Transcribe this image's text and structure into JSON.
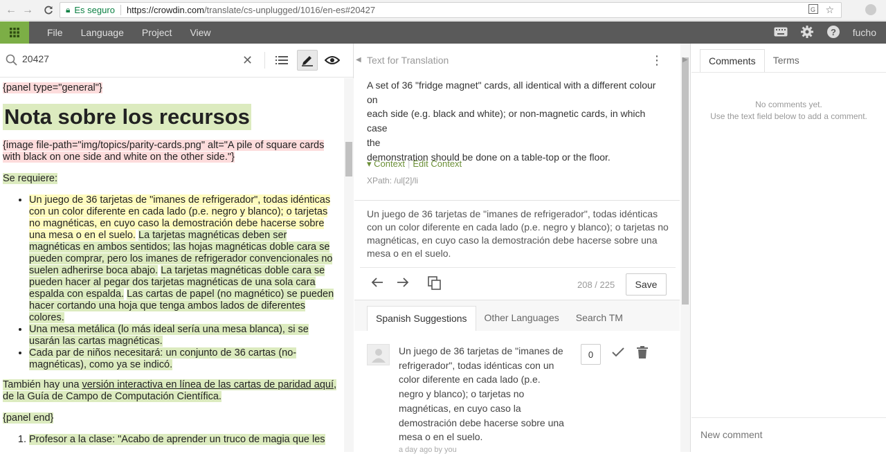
{
  "browser": {
    "secure_label": "Es seguro",
    "url_host": "https://crowdin.com",
    "url_path": "/translate/cs-unplugged/1016/en-es#20427"
  },
  "header": {
    "menu": [
      "File",
      "Language",
      "Project",
      "View"
    ],
    "username": "fucho"
  },
  "search": {
    "value": "20427"
  },
  "document": {
    "panel_start": "{panel type=\"general\"}",
    "title": "Nota sobre los recursos",
    "image_tag": "{image file-path=\"img/topics/parity-cards.png\" alt=\"A pile of square cards with black on one side and white on the other side.\"}",
    "requires": "Se requiere:",
    "item1_a": "Un juego de 36 tarjetas de \"imanes de refrigerador\", todas idénticas con un color diferente en cada lado (p.e. negro y blanco); o tarjetas no magnéticas, en cuyo caso la demostración debe hacerse sobre una mesa o en el suelo.",
    "item1_b": "La tarjetas magnéticas deben ser magnéticas en ambos sentidos; las hojas magnéticas doble cara se pueden comprar, pero los imanes de refrigerador convencionales no suelen adherirse boca abajo.",
    "item1_c": "La tarjetas magnéticas doble cara se pueden hacer al pegar dos tarjetas magnéticas de una sola cara espalda con espalda.",
    "item1_d": "Las cartas de papel (no magnético) se pueden hacer cortando una hoja que tenga ambos lados de diferentes colores.",
    "item2": "Una mesa metálica (lo más ideal sería una mesa blanca), si se usarán las cartas magnéticas.",
    "item3": "Cada par de niños necesitará: un conjunto de 36 cartas (no-magnéticas), como ya se indicó.",
    "also_pre": "También hay una ",
    "also_link": "versión interactiva en línea de las cartas de paridad aquí",
    "also_post": ", de la Guía de Campo de Computación Científica.",
    "panel_end": "{panel end}",
    "ol_item1": "Profesor a la clase: \"Acabo de aprender un truco de magia que les"
  },
  "editor": {
    "label": "Text for Translation",
    "source_lines": [
      "A set of 36 \"fridge magnet\" cards, all identical with a different colour",
      "on",
      "each side (e.g. black and white); or non-magnetic cards, in which case",
      "the",
      "demonstration should be done on a table-top or the floor."
    ],
    "context": "Context",
    "edit_context": "Edit Context",
    "xpath": "XPath: /ul[2]/li",
    "translation": "Un juego de 36 tarjetas de \"imanes de refrigerador\", todas idénticas con un color diferente en cada lado (p.e. negro y blanco); o tarjetas no magnéticas, en cuyo caso la demostración debe hacerse sobre una mesa o en el suelo.",
    "char_count": "208 / 225",
    "save": "Save"
  },
  "suggestions": {
    "tabs": [
      "Spanish Suggestions",
      "Other Languages",
      "Search TM"
    ],
    "text": "Un juego de 36 tarjetas de \"imanes de refrigerador\", todas idénticas con un color diferente en cada lado (p.e. negro y blanco); o tarjetas no magnéticas, en cuyo caso la demostración debe hacerse sobre una mesa o en el suelo.",
    "votes": "0",
    "meta": "a day ago by you"
  },
  "comments": {
    "tabs": [
      "Comments",
      "Terms"
    ],
    "empty_1": "No comments yet.",
    "empty_2": "Use the text field below to add a comment.",
    "placeholder": "New comment"
  }
}
